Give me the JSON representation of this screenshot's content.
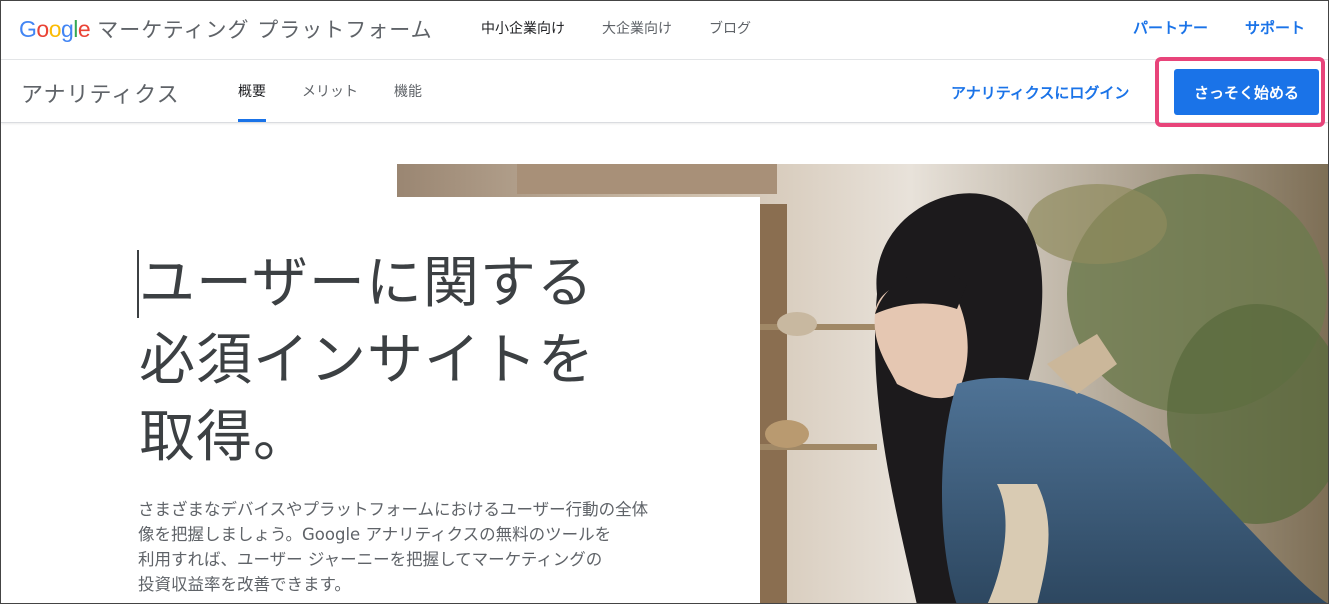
{
  "header": {
    "logo": {
      "google_letters": [
        "G",
        "o",
        "o",
        "g",
        "l",
        "e"
      ],
      "product": "マーケティング プラットフォーム"
    },
    "nav": [
      {
        "label": "中小企業向け",
        "active": true
      },
      {
        "label": "大企業向け",
        "active": false
      },
      {
        "label": "ブログ",
        "active": false
      }
    ],
    "right_links": [
      "パートナー",
      "サポート"
    ]
  },
  "subheader": {
    "product_name": "アナリティクス",
    "tabs": [
      {
        "label": "概要",
        "active": true
      },
      {
        "label": "メリット",
        "active": false
      },
      {
        "label": "機能",
        "active": false
      }
    ],
    "login_link": "アナリティクスにログイン",
    "cta_button": "さっそく始める"
  },
  "hero": {
    "headline_lines": [
      "ユーザーに関する",
      "必須インサイトを",
      "取得。"
    ],
    "description_lines": [
      "さまざまなデバイスやプラットフォームにおけるユーザー行動の全体",
      "像を把握しましょう。Google アナリティクスの無料のツールを",
      "利用すれば、ユーザー ジャーニーを把握してマーケティングの",
      "投資収益率を改善できます。"
    ]
  },
  "colors": {
    "accent_blue": "#1a73e8",
    "highlight_pink": "#e8447a",
    "text_dark": "#3c4043",
    "text_gray": "#5f6368"
  }
}
